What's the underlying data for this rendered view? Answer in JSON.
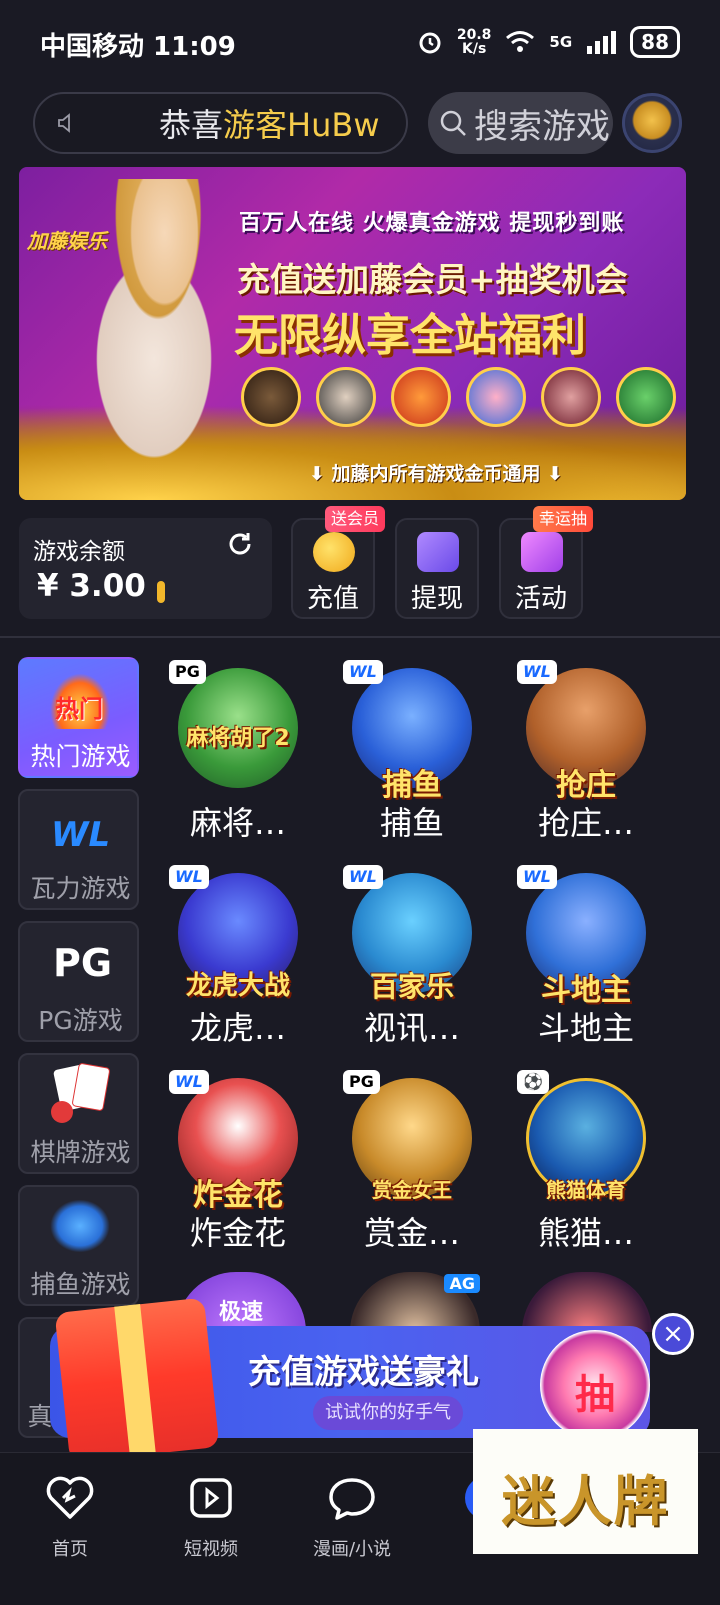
{
  "status_bar": {
    "carrier_time": "中国移动 11:09",
    "net_speed_value": "20.8",
    "net_speed_unit": "K/s",
    "network": "5G",
    "battery": "88"
  },
  "header": {
    "notice_prefix": "恭喜",
    "notice_user": "游客HuBw",
    "search_placeholder": "搜索游戏",
    "icons": [
      "speaker-icon",
      "search-icon",
      "customer-service-icon"
    ]
  },
  "banner": {
    "brand": "加藤娱乐",
    "line1": "百万人在线  火爆真金游戏  提现秒到账",
    "line2": "充值送加藤会员+抽奖机会",
    "line3": "无限纵享全站福利",
    "footer": "加藤内所有游戏金币通用"
  },
  "balance": {
    "label": "游戏余额",
    "value": "¥ 3.00"
  },
  "quick_actions": [
    {
      "label": "充值",
      "badge": "送会员",
      "color": "#f5c42a"
    },
    {
      "label": "提现",
      "badge": "",
      "color": "#8a63ff"
    },
    {
      "label": "活动",
      "badge": "幸运抽",
      "color": "#c050ff"
    }
  ],
  "sidebar": {
    "items": [
      {
        "label": "热门游戏",
        "icon_text": "热门"
      },
      {
        "label": "瓦力游戏",
        "icon_text": "WL"
      },
      {
        "label": "PG游戏",
        "icon_text": "PG"
      },
      {
        "label": "棋牌游戏",
        "icon_text": ""
      },
      {
        "label": "捕鱼游戏",
        "icon_text": ""
      },
      {
        "label": "真",
        "icon_text": ""
      }
    ]
  },
  "games": [
    {
      "name": "麻将…",
      "art_text": "麻将胡了2",
      "provider": "PG",
      "color": "#2f8a3a"
    },
    {
      "name": "捕鱼",
      "art_text": "捕鱼",
      "provider": "WL",
      "color": "#2a6de0"
    },
    {
      "name": "抢庄…",
      "art_text": "抢庄",
      "provider": "WL",
      "color": "#b85a2a"
    },
    {
      "name": "龙虎…",
      "art_text": "龙虎大战",
      "provider": "WL",
      "color": "#3a3ad0"
    },
    {
      "name": "视讯…",
      "art_text": "百家乐",
      "provider": "WL",
      "color": "#2a8ad0"
    },
    {
      "name": "斗地主",
      "art_text": "斗地主",
      "provider": "WL",
      "color": "#3070d8"
    },
    {
      "name": "炸金花",
      "art_text": "炸金花",
      "provider": "WL",
      "color": "#d83030"
    },
    {
      "name": "赏金…",
      "art_text": "赏金女王",
      "provider": "PG",
      "color": "#c88a2a"
    },
    {
      "name": "熊猫…",
      "art_text": "熊猫体育",
      "provider": "",
      "color": "#1a5ab0"
    }
  ],
  "partial_row": {
    "label_1": "极速",
    "provider_3": "AG"
  },
  "promo": {
    "title": "充值游戏送豪礼",
    "pill": "试试你的好手气",
    "draw": "抽",
    "close": "×"
  },
  "nav": {
    "items": [
      {
        "label": "首页"
      },
      {
        "label": "短视频"
      },
      {
        "label": "漫画/小说"
      }
    ]
  },
  "watermark": "迷人牌"
}
